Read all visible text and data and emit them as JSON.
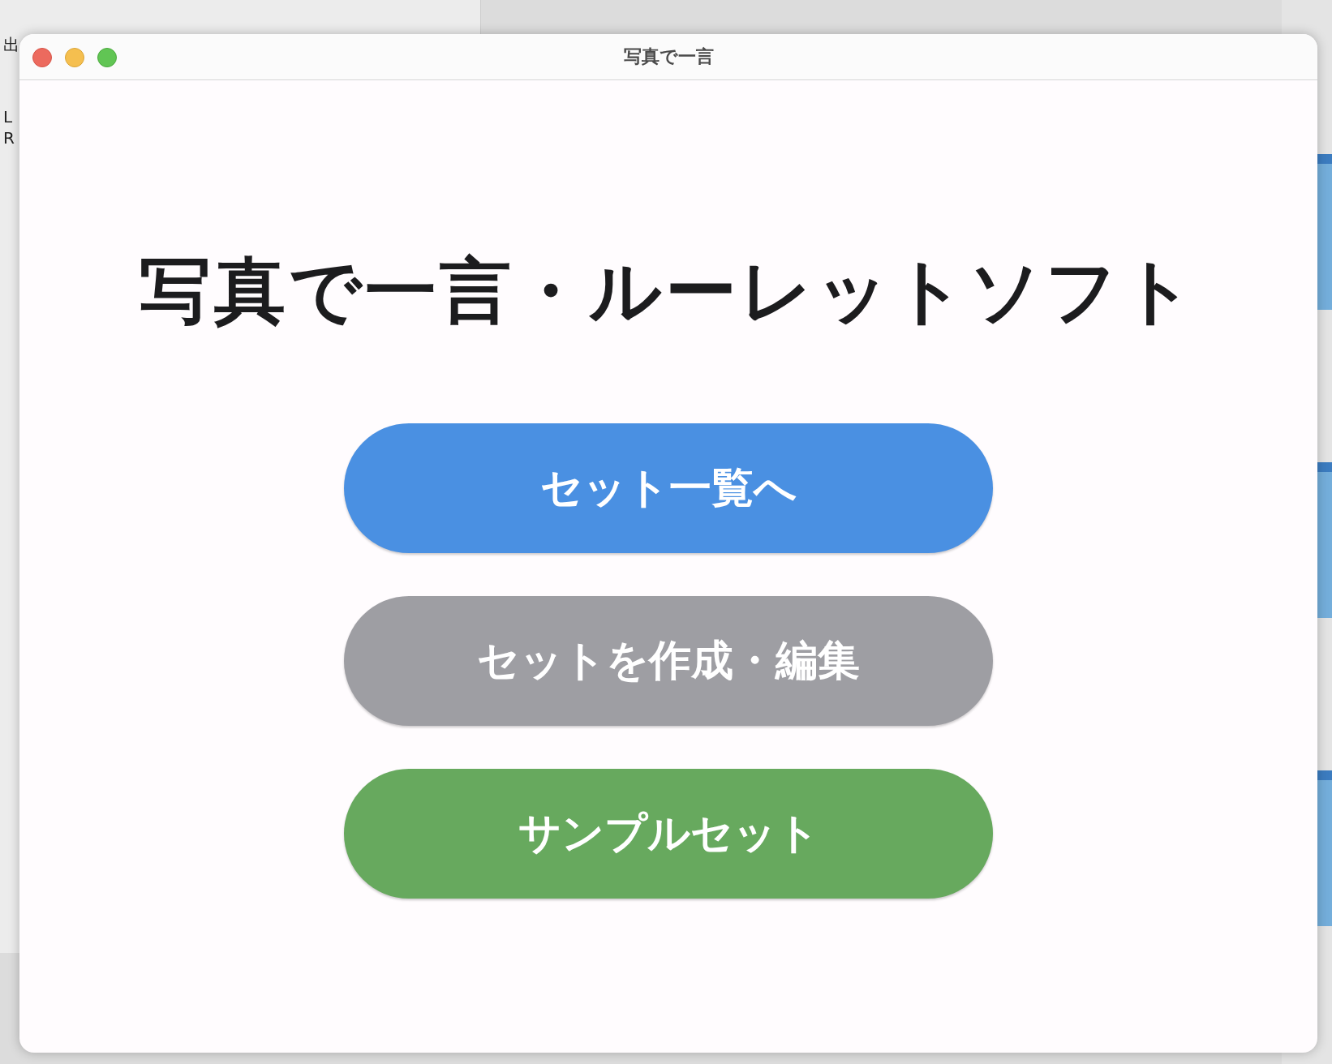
{
  "background": {
    "left_texts": [
      "出",
      "L",
      "R"
    ]
  },
  "window": {
    "title": "写真で一言"
  },
  "heading": "写真で一言・ルーレットソフト",
  "buttons": [
    {
      "label": "セット一覧へ",
      "color": "#4a90e2"
    },
    {
      "label": "セットを作成・編集",
      "color": "#9e9ea3"
    },
    {
      "label": "サンプルセット",
      "color": "#67a95e"
    }
  ]
}
